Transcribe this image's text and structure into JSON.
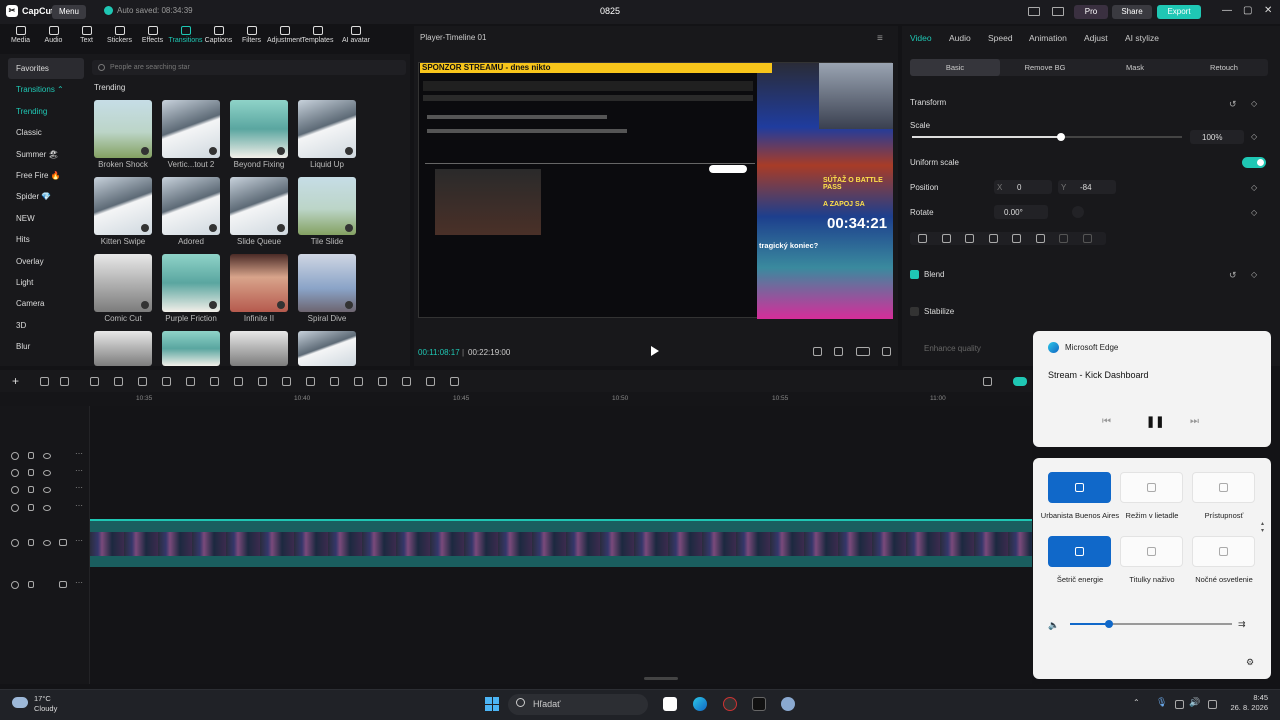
{
  "titlebar": {
    "app_name": "CapCut",
    "menu_label": "Menu",
    "autosave": "Auto saved: 08:34:39",
    "project_name": "0825",
    "pro_label": "Pro",
    "share_label": "Share",
    "export_label": "Export",
    "minimize": "—",
    "maximize": "▢",
    "close": "✕"
  },
  "media_toolbar": [
    {
      "label": "Media",
      "icon": "media-icon"
    },
    {
      "label": "Audio",
      "icon": "audio-icon"
    },
    {
      "label": "Text",
      "icon": "text-icon"
    },
    {
      "label": "Stickers",
      "icon": "stickers-icon"
    },
    {
      "label": "Effects",
      "icon": "effects-icon"
    },
    {
      "label": "Transitions",
      "icon": "transitions-icon",
      "active": true
    },
    {
      "label": "Captions",
      "icon": "captions-icon"
    },
    {
      "label": "Filters",
      "icon": "filters-icon"
    },
    {
      "label": "Adjustment",
      "icon": "adjustment-icon"
    },
    {
      "label": "Templates",
      "icon": "templates-icon"
    },
    {
      "label": "AI avatar",
      "icon": "ai-avatar-icon"
    }
  ],
  "categories": [
    {
      "label": "Favorites",
      "selected": true
    },
    {
      "label": "Transitions ⌃",
      "teal": true
    },
    {
      "label": "Trending",
      "teal": true
    },
    {
      "label": "Classic"
    },
    {
      "label": "Summer 🏖"
    },
    {
      "label": "Free Fire 🔥"
    },
    {
      "label": "Spider 💎"
    },
    {
      "label": "NEW"
    },
    {
      "label": "Hits"
    },
    {
      "label": "Overlay"
    },
    {
      "label": "Light"
    },
    {
      "label": "Camera"
    },
    {
      "label": "3D"
    },
    {
      "label": "Blur"
    }
  ],
  "search": {
    "placeholder": "People are searching star"
  },
  "trending_heading": "Trending",
  "transitions": [
    {
      "label": "Broken Shock",
      "style": "chair"
    },
    {
      "label": "Vertic...tout 2",
      "style": "mtn"
    },
    {
      "label": "Beyond Fixing",
      "style": "person"
    },
    {
      "label": "Liquid Up",
      "style": "mtn"
    },
    {
      "label": "Kitten Swipe",
      "style": "mtn"
    },
    {
      "label": "Adored",
      "style": "mtn"
    },
    {
      "label": "Slide Queue",
      "style": "mtn"
    },
    {
      "label": "Tile Slide",
      "style": "chair"
    },
    {
      "label": "Comic Cut",
      "style": "bw"
    },
    {
      "label": "Purple Friction",
      "style": "person"
    },
    {
      "label": "Infinite II",
      "style": "face"
    },
    {
      "label": "Spiral Dive",
      "style": "tower"
    },
    {
      "label": "",
      "style": "bw"
    },
    {
      "label": "",
      "style": "person"
    },
    {
      "label": "",
      "style": "bw"
    },
    {
      "label": "",
      "style": "mtn"
    }
  ],
  "player": {
    "title": "Player-Timeline 01",
    "banner": "SPONZOR STREAMU - dnes nikto",
    "timer_overlay": "00:34:21",
    "overlay_text_1": "SÚŤAŽ O BATTLE PASS",
    "overlay_text_2": "A ZAPOJ SA",
    "overlay_text_3": "tragický koniec?",
    "current_time": "00:11:08:17",
    "total_time": "00:22:19:00"
  },
  "right_panel": {
    "tabs": [
      "Video",
      "Audio",
      "Speed",
      "Animation",
      "Adjust",
      "AI stylize"
    ],
    "subtabs": [
      "Basic",
      "Remove BG",
      "Mask",
      "Retouch"
    ],
    "transform_label": "Transform",
    "scale_label": "Scale",
    "scale_value": "100%",
    "scale_fraction": 0.55,
    "uniform_scale_label": "Uniform scale",
    "position_label": "Position",
    "pos_x_label": "X",
    "pos_x_value": "0",
    "pos_y_label": "Y",
    "pos_y_value": "-84",
    "rotate_label": "Rotate",
    "rotate_value": "0.00°",
    "blend_label": "Blend",
    "stabilize_label": "Stabilize",
    "enhance_label": "Enhance quality"
  },
  "timeline": {
    "ruler": [
      "10:35",
      "10:40",
      "10:45",
      "10:50",
      "10:55",
      "11:00",
      "11:05"
    ]
  },
  "edge_popup": {
    "app_name": "Microsoft Edge",
    "media_title": "Stream - Kick Dashboard"
  },
  "quick_settings": {
    "tiles": [
      {
        "label": "Urbanista Buenos Aires",
        "on": true
      },
      {
        "label": "Režim v lietadle",
        "on": false
      },
      {
        "label": "Prístupnosť",
        "on": false
      },
      {
        "label": "Šetrič energie",
        "on": true
      },
      {
        "label": "Titulky naživo",
        "on": false
      },
      {
        "label": "Nočné osvetlenie",
        "on": false
      }
    ],
    "volume_fraction": 0.24
  },
  "taskbar": {
    "temp": "17°C",
    "weather": "Cloudy",
    "search_placeholder": "Hľadať",
    "time": "8:45",
    "date": "26. 8. 2026"
  },
  "colors": {
    "accent": "#1fc7b4",
    "win_blue": "#1068c9",
    "banner": "#f7c51b"
  }
}
